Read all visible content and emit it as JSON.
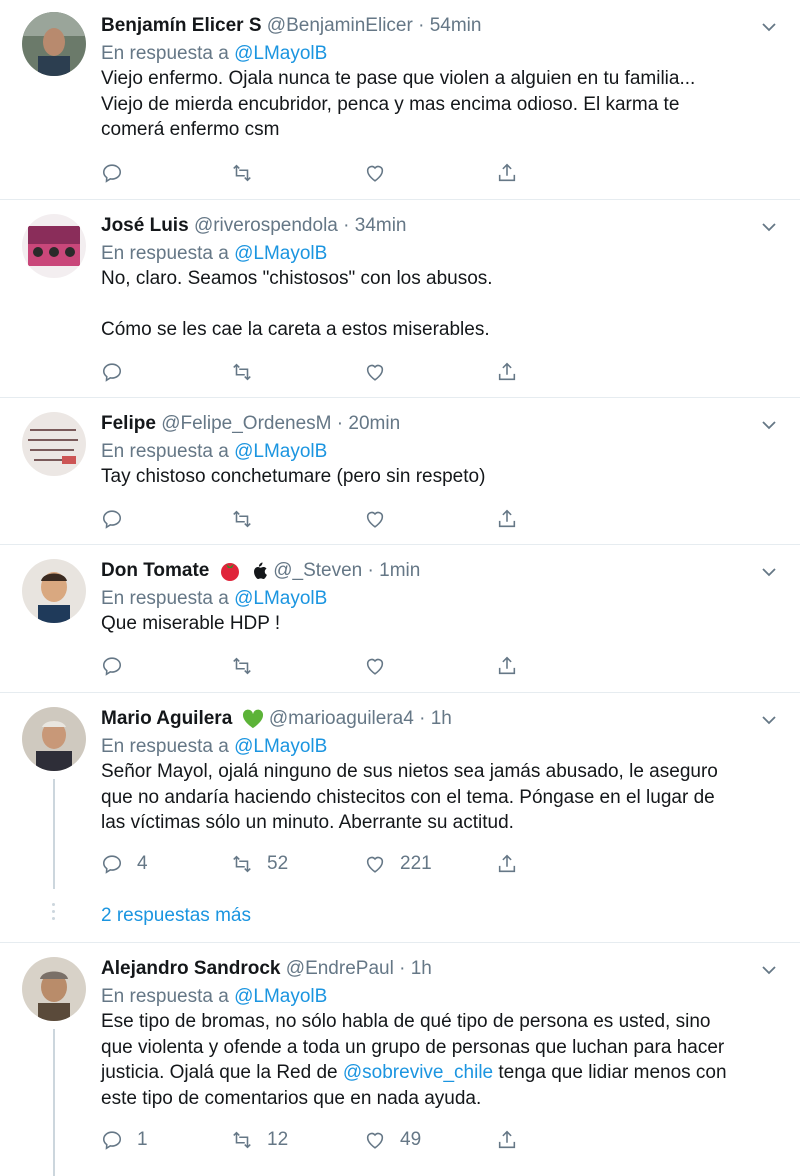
{
  "reply_prefix": "En respuesta a ",
  "reply_target": "@LMayolB",
  "icons": {
    "reply": "reply-icon",
    "retweet": "retweet-icon",
    "like": "like-icon",
    "share": "share-icon",
    "more": "chevron-down-icon"
  },
  "colors": {
    "link": "#1b95e0",
    "muted": "#657786",
    "text": "#14171a"
  },
  "tweets": [
    {
      "name": "Benjamín Elicer S",
      "handle": "@BenjaminElicer",
      "time": "54min",
      "body": [
        "Viejo enfermo. Ojala nunca te pase que violen a alguien en tu familia...",
        "Viejo de mierda encubridor, penca y mas encima odioso. El karma te",
        "comerá enfermo csm"
      ]
    },
    {
      "name": "José Luis",
      "handle": "@riverospendola",
      "time": "34min",
      "body": [
        "No, claro. Seamos \"chistosos\" con los abusos.",
        "",
        "Cómo se les cae la careta a estos miserables."
      ]
    },
    {
      "name": "Felipe",
      "handle": "@Felipe_OrdenesM",
      "time": "20min",
      "body": [
        "Tay chistoso conchetumare (pero sin respeto)"
      ]
    },
    {
      "name": "Don Tomate",
      "handle": "@_Steven",
      "time": "1min",
      "emojis": [
        "tomato-emoji",
        "apple-logo-emoji"
      ],
      "body": [
        "Que miserable HDP !"
      ]
    },
    {
      "name": "Mario Aguilera",
      "handle": "@marioaguilera4",
      "time": "1h",
      "emojis": [
        "green-heart-emoji"
      ],
      "body": [
        "Señor Mayol, ojalá ninguno de sus nietos sea jamás abusado, le aseguro",
        "que no andaría haciendo chistecitos con el tema. Póngase en el lugar de",
        "las víctimas sólo un minuto. Aberrante su actitud."
      ],
      "replies": "4",
      "retweets": "52",
      "likes": "221",
      "more_replies": "2 respuestas más"
    },
    {
      "name": "Alejandro Sandrock",
      "handle": "@EndrePaul",
      "time": "1h",
      "body_parts": {
        "line1": "Ese tipo de bromas, no sólo habla de qué tipo de persona es usted, sino",
        "line2": "que violenta y ofende a toda un grupo de personas que luchan para hacer",
        "line3_pre": "justicia. Ojalá que la Red de ",
        "line3_mention": "@sobrevive_chile",
        "line3_post": " tenga que lidiar menos con",
        "line4": "este tipo de comentarios que en nada ayuda."
      },
      "replies": "1",
      "retweets": "12",
      "likes": "49"
    }
  ]
}
